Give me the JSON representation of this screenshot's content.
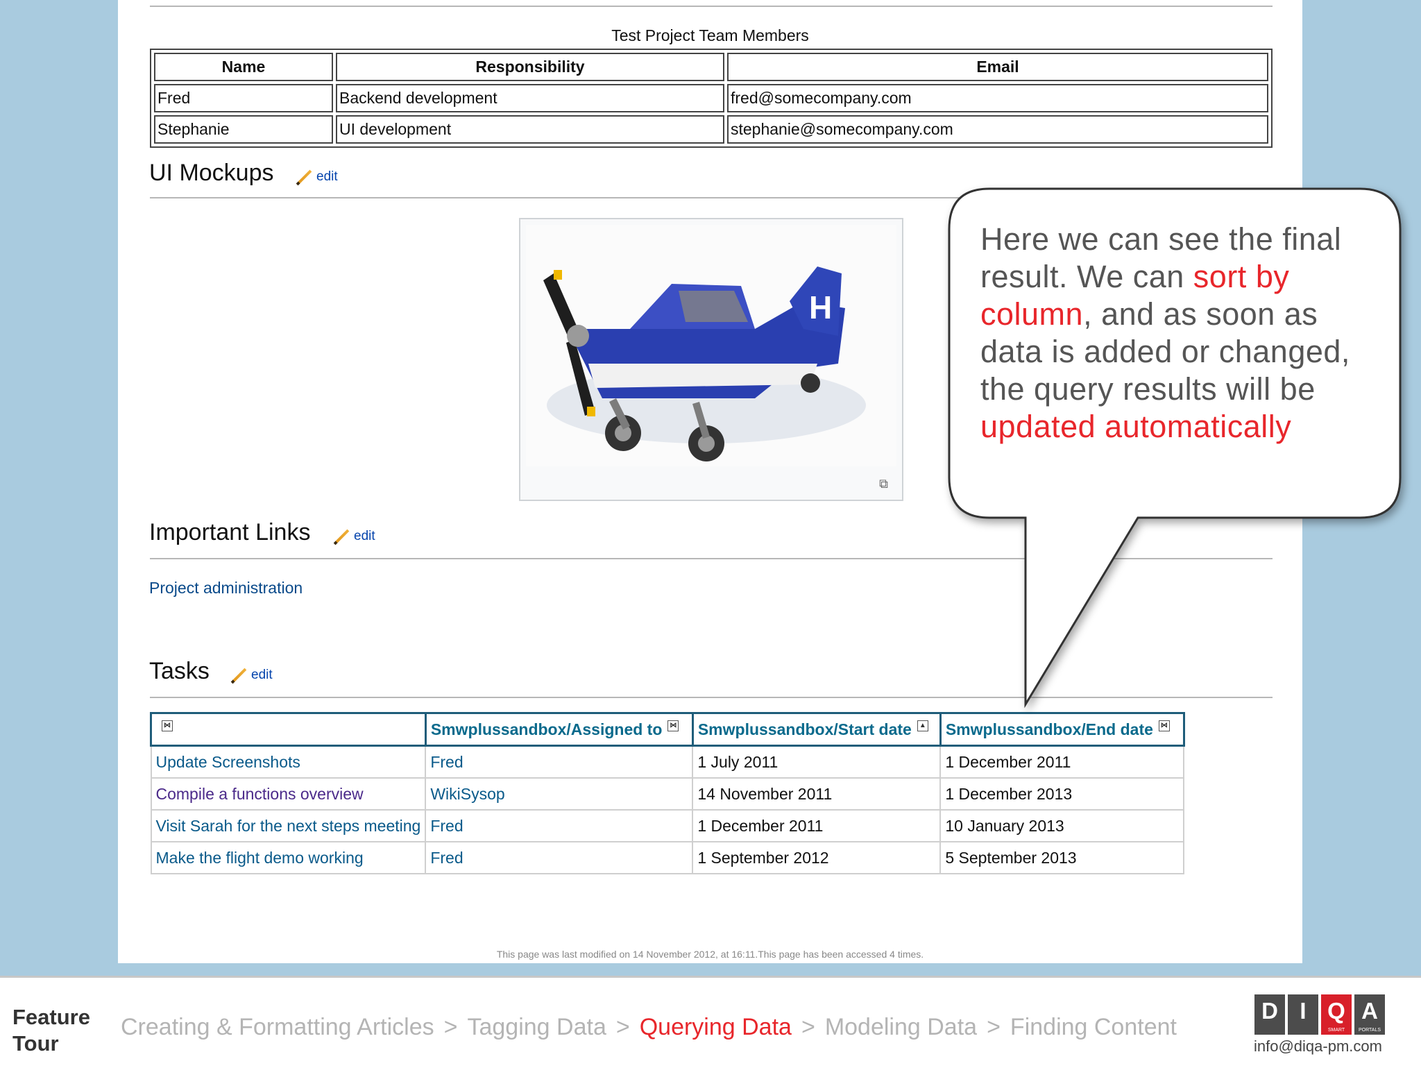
{
  "members": {
    "caption": "Test Project Team Members",
    "headers": [
      "Name",
      "Responsibility",
      "Email"
    ],
    "rows": [
      [
        "Fred",
        "Backend development",
        "fred@somecompany.com"
      ],
      [
        "Stephanie",
        "UI development",
        "stephanie@somecompany.com"
      ]
    ]
  },
  "sections": {
    "mockups": {
      "title": "UI Mockups",
      "edit": "edit"
    },
    "links": {
      "title": "Important Links",
      "edit": "edit",
      "items": [
        "Project administration"
      ]
    },
    "tasks": {
      "title": "Tasks",
      "edit": "edit"
    }
  },
  "tasks_table": {
    "headers": [
      "",
      "Smwplussandbox/Assigned to",
      "Smwplussandbox/Start date",
      "Smwplussandbox/End date"
    ],
    "rows": [
      [
        "Update Screenshots",
        "Fred",
        "1 July 2011",
        "1 December 2011"
      ],
      [
        "Compile a functions overview",
        "WikiSysop",
        "14 November 2011",
        "1 December 2013"
      ],
      [
        "Visit Sarah for the next steps meeting",
        "Fred",
        "1 December 2011",
        "10 January 2013"
      ],
      [
        "Make the flight demo working",
        "Fred",
        "1 September 2012",
        "5 September 2013"
      ]
    ]
  },
  "footer_note": "This page was last modified on 14 November 2012, at 16:11.This page has been accessed 4 times.",
  "callout": {
    "p1": "Here we can see the final result. We can ",
    "h1": "sort by column",
    "p2": ", and as soon as data is added or changed, the query results will be ",
    "h2": "updated automatically"
  },
  "bottom_bar": {
    "feature": "Feature",
    "tour": "Tour",
    "breadcrumbs": [
      "Creating & Formatting Articles",
      "Tagging Data",
      "Querying Data",
      "Modeling Data",
      "Finding Content"
    ],
    "separator": ">",
    "logo_letters": [
      "D",
      "I",
      "Q",
      "A"
    ],
    "logo_sub": [
      "SMART",
      "PORTALS"
    ],
    "email": "info@diqa-pm.com"
  },
  "colors": {
    "accent": "#e8262b",
    "link": "#0a5a8a",
    "background": "#a9cbdf"
  }
}
